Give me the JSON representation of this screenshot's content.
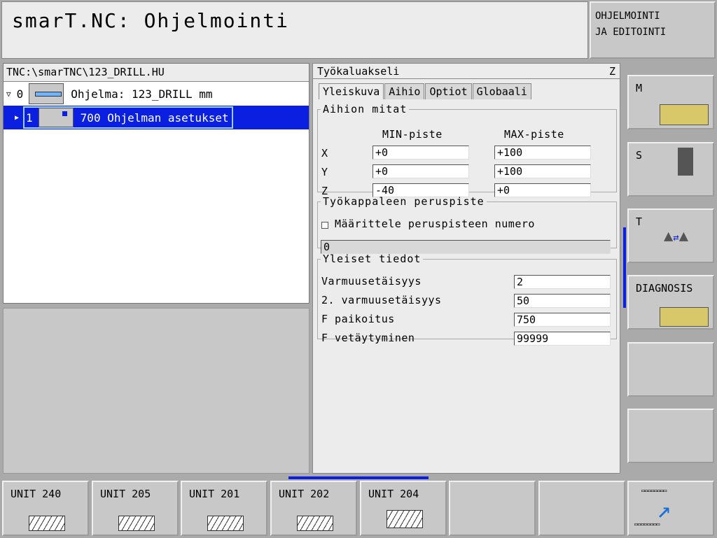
{
  "title": "smarT.NC: Ohjelmointi",
  "mode": {
    "line1": "OHJELMOINTI",
    "line2": "JA EDITOINTI"
  },
  "tree": {
    "path": "TNC:\\smarTNC\\123_DRILL.HU",
    "items": [
      {
        "index": "0",
        "label": "Ohjelma: 123_DRILL mm",
        "expanded": true
      },
      {
        "index": "1",
        "label": "700 Ohjelman asetukset",
        "selected": true
      }
    ]
  },
  "form": {
    "header": "Työkaluakseli",
    "axis": "Z",
    "tabs": [
      "Yleiskuva",
      "Aihio",
      "Optiot",
      "Globaali"
    ],
    "active_tab": "Yleiskuva",
    "blank": {
      "legend": "Aihion mitat",
      "min_header": "MIN-piste",
      "max_header": "MAX-piste",
      "rows": [
        {
          "axis": "X",
          "min": "+0",
          "max": "+100"
        },
        {
          "axis": "Y",
          "min": "+0",
          "max": "+100"
        },
        {
          "axis": "Z",
          "min": "-40",
          "max": "+0"
        }
      ]
    },
    "datum": {
      "legend": "Työkappaleen peruspiste",
      "checkbox_label": "Määrittele peruspisteen numero",
      "checked": false,
      "value": "0"
    },
    "general": {
      "legend": "Yleiset tiedot",
      "fields": [
        {
          "label": "Varmuusetäisyys",
          "value": "2"
        },
        {
          "label": "2. varmuusetäisyys",
          "value": "50"
        },
        {
          "label": "F paikoitus",
          "value": "750"
        },
        {
          "label": "F vetäytyminen",
          "value": "99999"
        }
      ]
    }
  },
  "right_softkeys": [
    {
      "label": "M",
      "icon": "machine-spindle-icon"
    },
    {
      "label": "S",
      "icon": "spindle-rotation-icon"
    },
    {
      "label": "T",
      "icon": "tool-change-icon"
    },
    {
      "label": "DIAGNOSIS",
      "icon": "diagnosis-icon"
    },
    {
      "label": ""
    },
    {
      "label": ""
    }
  ],
  "bottom_softkeys": [
    {
      "label": "UNIT 240",
      "icon": "centering-icon"
    },
    {
      "label": "UNIT 205",
      "icon": "deep-drill-icon"
    },
    {
      "label": "UNIT 201",
      "icon": "reaming-icon"
    },
    {
      "label": "UNIT 202",
      "icon": "boring-icon"
    },
    {
      "label": "UNIT 204",
      "icon": "back-boring-icon"
    },
    {
      "label": ""
    },
    {
      "label": ""
    },
    {
      "label": "",
      "icon": "next-softkey-row-icon"
    }
  ],
  "colors": {
    "selection": "#0a1fe0",
    "accent_bar": "#0a1fe0"
  }
}
